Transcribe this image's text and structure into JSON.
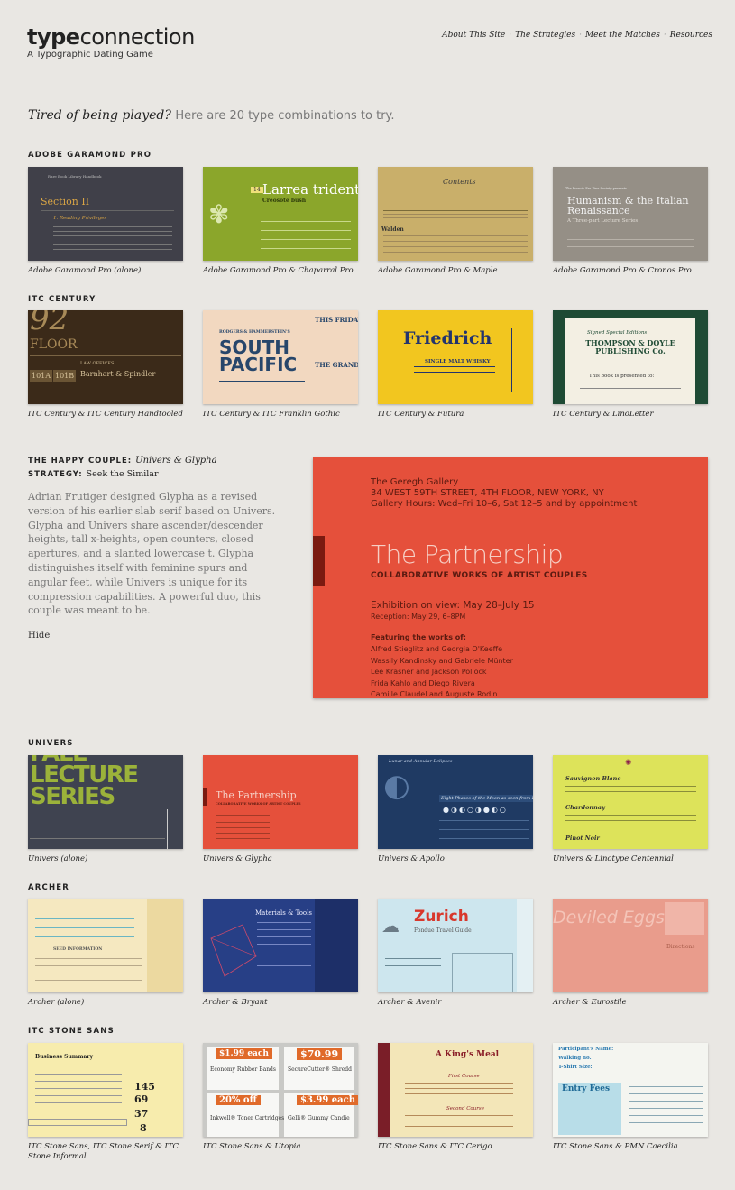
{
  "header": {
    "logo_bold": "type",
    "logo_rest": "connection",
    "tagline": "A Typographic Dating Game",
    "nav": [
      "About This Site",
      "The Strategies",
      "Meet the Matches",
      "Resources"
    ],
    "nav_sep": "·"
  },
  "intro": {
    "em": "Tired of being played?",
    "rest": "Here are 20 type combinations to try."
  },
  "sections": [
    {
      "title": "ADOBE GARAMOND PRO",
      "cards": [
        {
          "caption": "Adobe Garamond Pro (alone)",
          "thumb": {
            "title": "Section II",
            "sub": "1. Reading Privileges",
            "small": "Rare Book Library Handbook"
          }
        },
        {
          "caption": "Adobe Garamond Pro & Chaparral Pro",
          "thumb": {
            "title": "Larrea tridentat",
            "sub": "Creosote bush",
            "tag": "14"
          }
        },
        {
          "caption": "Adobe Garamond Pro & Maple",
          "thumb": {
            "title": "Contents",
            "sub": "Walden"
          }
        },
        {
          "caption": "Adobe Garamond Pro & Cronos Pro",
          "thumb": {
            "title": "Humanism & the Italian Renaissance",
            "sub": "A Three-part Lecture Series",
            "small": "The Francis Ess Fine Society presents"
          }
        }
      ]
    },
    {
      "title": "ITC CENTURY",
      "cards": [
        {
          "caption": "ITC Century & ITC Century Handtooled",
          "thumb": {
            "big": "92",
            "floor": "FLOOR",
            "firm": "Barnhart & Spindler",
            "office": "LAW OFFICES",
            "s1": "101A",
            "s2": "101B"
          }
        },
        {
          "caption": "ITC Century & ITC Franklin Gothic",
          "thumb": {
            "title1": "SOUTH",
            "title2": "PACIFIC",
            "top": "RODGERS & HAMMERSTEIN'S",
            "side": "THIS FRIDAY A",
            "side2": "THE GRAND ST"
          }
        },
        {
          "caption": "ITC Century & Futura",
          "thumb": {
            "title": "Friedrich",
            "sub": "SINGLE MALT WHISKY"
          }
        },
        {
          "caption": "ITC Century & LinoLetter",
          "thumb": {
            "title": "THOMPSON & DOYLE PUBLISHING Co.",
            "sub": "Signed Special Editions",
            "line": "This book is presented to:"
          }
        }
      ]
    },
    {
      "title": "UNIVERS",
      "cards": [
        {
          "caption": "Univers (alone)",
          "thumb": {
            "l1": "FALL",
            "l2": "LECTURE",
            "l3": "SERIES"
          }
        },
        {
          "caption": "Univers & Glypha",
          "thumb": {
            "title": "The Partnership",
            "sub": "COLLABORATIVE WORKS OF ARTIST COUPLES"
          }
        },
        {
          "caption": "Univers & Apollo",
          "thumb": {
            "title": "Eight Phases of the Moon as seen from Earth",
            "top": "Lunar and Annular Eclipses"
          }
        },
        {
          "caption": "Univers & Linotype Centennial",
          "thumb": {
            "w1": "Sauvignon Blanc",
            "w2": "Chardonnay",
            "w3": "Pinot Noir"
          }
        }
      ]
    },
    {
      "title": "ARCHER",
      "cards": [
        {
          "caption": "Archer (alone)",
          "thumb": {
            "title": "SEED INFORMATION"
          }
        },
        {
          "caption": "Archer & Bryant",
          "thumb": {
            "title": "Materials & Tools"
          }
        },
        {
          "caption": "Archer & Avenir",
          "thumb": {
            "title": "Zurich",
            "sub": "Fondue Travel Guide"
          }
        },
        {
          "caption": "Archer & Eurostile",
          "thumb": {
            "title": "Deviled Eggs",
            "sub": "Directions"
          }
        }
      ]
    },
    {
      "title": "ITC STONE SANS",
      "cards": [
        {
          "caption": "ITC Stone Sans, ITC Stone Serif & ITC Stone Informal",
          "thumb": {
            "title": "Business Summary",
            "n1": "145",
            "n2": "69",
            "n3": "37",
            "n4": "8"
          }
        },
        {
          "caption": "ITC Stone Sans & Utopia",
          "thumb": {
            "p1": "$1.99 each",
            "p2": "$70.99",
            "p3": "20% off",
            "p4": "$3.99 each",
            "l1": "Economy Rubber Bands",
            "l2": "SecureCutter® Shredd",
            "l3": "Inkwell® Toner Cartridges",
            "l4": "Gelli® Gummy Candie"
          }
        },
        {
          "caption": "ITC Stone Sans & ITC Cerigo",
          "thumb": {
            "title": "A King's Meal",
            "c1": "First Course",
            "c2": "Second Course"
          }
        },
        {
          "caption": "ITC Stone Sans & PMN Caecilia",
          "thumb": {
            "title": "Entry Fees",
            "sub": "Participant's Name:",
            "w": "Walking no.",
            "t": "T-Shirt Size:"
          }
        }
      ]
    }
  ],
  "feature": {
    "label": "THE HAPPY COUPLE:",
    "pair": "Univers & Glypha",
    "strategy_label": "STRATEGY:",
    "strategy": "Seek the Similar",
    "body": "Adrian Frutiger designed Glypha as a revised version of his earlier slab serif based on Univers. Glypha and Univers share ascender/descender heights, tall x-heights, open counters, closed apertures, and a slanted lowercase t. Glypha distinguishes itself with feminine spurs and angular feet, while Univers is unique for its compression capabilities. A powerful duo, this couple was meant to be.",
    "hide": "Hide",
    "image": {
      "gallery": "The Geregh Gallery",
      "address": "34 WEST 59TH STREET, 4TH FLOOR, NEW YORK, NY",
      "hours": "Gallery Hours: Wed–Fri 10–6, Sat 12–5 and by appointment",
      "title": "The Partnership",
      "subtitle": "COLLABORATIVE WORKS OF ARTIST COUPLES",
      "exhibition": "Exhibition on view: May 28–July 15",
      "reception": "Reception: May 29, 6–8PM",
      "featuring": "Featuring the works of:",
      "artists": [
        "Alfred Stieglitz and Georgia O'Keeffe",
        "Wassily Kandinsky and Gabriele Münter",
        "Lee Krasner and Jackson Pollock",
        "Frida Kahlo and Diego Rivera",
        "Camille Claudel and Auguste Rodin"
      ]
    }
  },
  "colors": {
    "background": "#e9e7e3",
    "accent": "#e5503b"
  }
}
